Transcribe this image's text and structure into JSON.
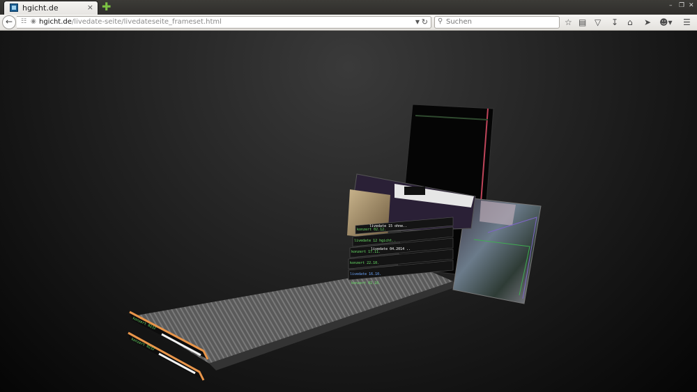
{
  "tab": {
    "title": "hgicht.de",
    "close_glyph": "×",
    "new_tab_glyph": "✚"
  },
  "window_controls": {
    "minimize": "–",
    "restore": "❐",
    "close": "✕"
  },
  "nav": {
    "url_domain": "hgicht.de",
    "url_path": "/livedate-seite/livedateseite_frameset.html",
    "search_placeholder": "Suchen"
  },
  "page": {
    "labels": [
      "konzert 02.12.",
      "livedate 15 ohne..",
      "livedate 12 hgicht..",
      "konzert 17.11.",
      "livedate 04.2014 ..",
      "konzert 22.10.",
      "livedate 16.10.",
      "konzert 02.10.",
      "konzert 0232",
      "konzert 0232"
    ]
  },
  "colors": {
    "accent_orange": "#e8954a",
    "label_green": "#6be36a",
    "label_blue": "#6fa8ff"
  }
}
